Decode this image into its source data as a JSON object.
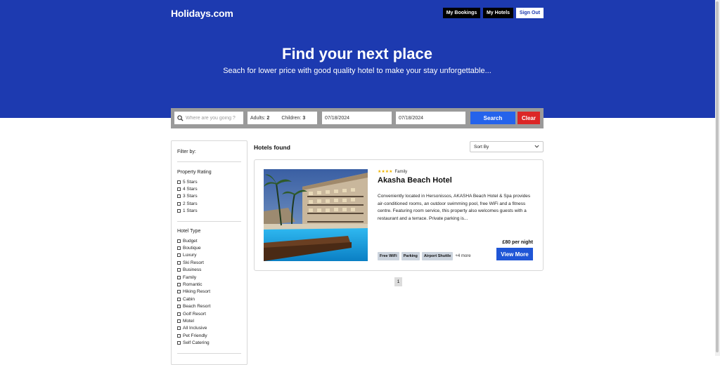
{
  "header": {
    "logo": "Holidays.com",
    "nav": [
      "My Bookings",
      "My Hotels",
      "Sign Out"
    ]
  },
  "hero": {
    "title": "Find your next place",
    "subtitle": "Seach for lower price with good quality hotel to make your stay unforgettable..."
  },
  "search": {
    "destination_placeholder": "Where are you going ?",
    "adults_label": "Adults:",
    "adults_value": "2",
    "children_label": "Children:",
    "children_value": "3",
    "checkin": "07/18/2024",
    "checkout": "07/18/2024",
    "search_label": "Search",
    "clear_label": "Clear",
    "search_color": "#2563eb",
    "clear_color": "#dc2626"
  },
  "filters": {
    "title": "Filter by:",
    "rating_title": "Property Rating",
    "ratings": [
      "5 Stars",
      "4 Stars",
      "3 Stars",
      "2 Stars",
      "1 Stars"
    ],
    "type_title": "Hotel Type",
    "types": [
      "Budget",
      "Boutique",
      "Luxury",
      "Ski Resort",
      "Business",
      "Family",
      "Romantic",
      "Hiking Resort",
      "Cabin",
      "Beach Resort",
      "Golf Resort",
      "Motel",
      "All Inclusive",
      "Pet Friendly",
      "Self Catering"
    ]
  },
  "results": {
    "heading": "Hotels found",
    "sort_label": "Sort By"
  },
  "hotel": {
    "stars": "★★★★",
    "type": "Family",
    "name": "Akasha Beach Hotel",
    "description": "Conveniently located in Hersonissos, AKASHA Beach Hotel & Spa provides air-conditioned rooms, an outdoor swimming pool, free WiFi and a fitness centre. Featuring room service, this property also welcomes guests with a restaurant and a terrace. Private parking is...",
    "amenities": [
      "Free WiFi",
      "Parking",
      "Airport Shuttle"
    ],
    "more": "+4 more",
    "price": "£80 per night",
    "view_label": "View More"
  },
  "pagination": {
    "current": "1"
  },
  "colors": {
    "brand": "#1d3ab0",
    "button_blue": "#1f56d6",
    "star": "#f0b400"
  }
}
